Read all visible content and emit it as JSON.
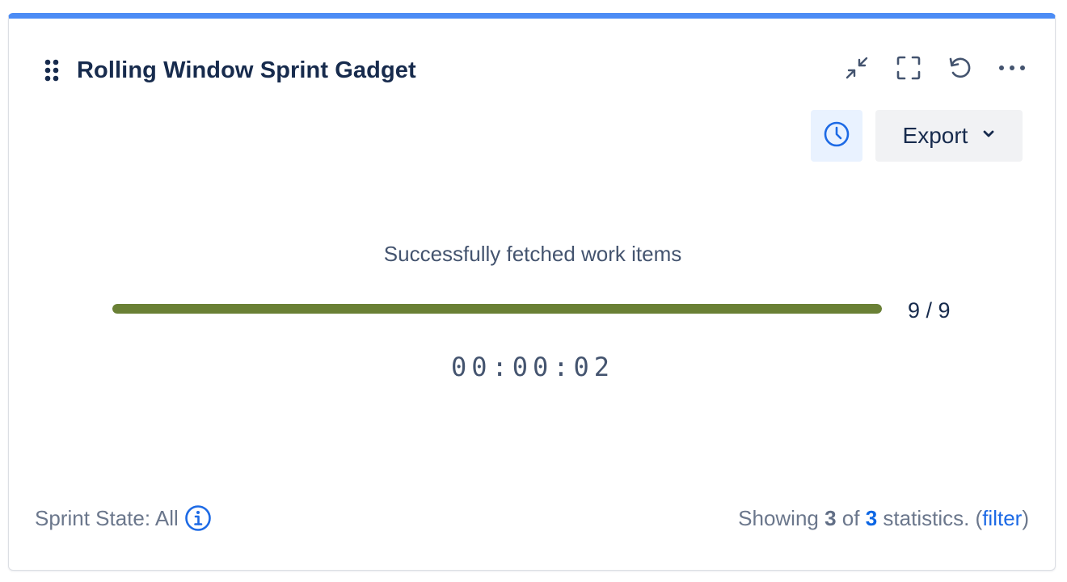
{
  "gadget": {
    "title": "Rolling Window Sprint Gadget",
    "accent_color": "#4c8cf5"
  },
  "header_actions": [
    {
      "name": "minimize-icon"
    },
    {
      "name": "fullscreen-icon"
    },
    {
      "name": "refresh-icon"
    },
    {
      "name": "more-options-icon"
    }
  ],
  "toolbar": {
    "history_icon": "clock-icon",
    "export_label": "Export",
    "export_icon": "chevron-down-icon"
  },
  "progress": {
    "status_text": "Successfully fetched work items",
    "completed": 9,
    "total": 9,
    "count_label": "9 / 9",
    "fill_fraction": 1.0,
    "fill_color": "#6a8035"
  },
  "timer": {
    "elapsed": "00:00:02"
  },
  "footer": {
    "sprint_state_label": "Sprint State: All",
    "info_icon": "info-icon",
    "showing_prefix": "Showing ",
    "shown_count": "3",
    "of_text": " of ",
    "total_count": "3",
    "stats_suffix": " statistics. (",
    "filter_link": "filter",
    "close_paren": ")"
  }
}
